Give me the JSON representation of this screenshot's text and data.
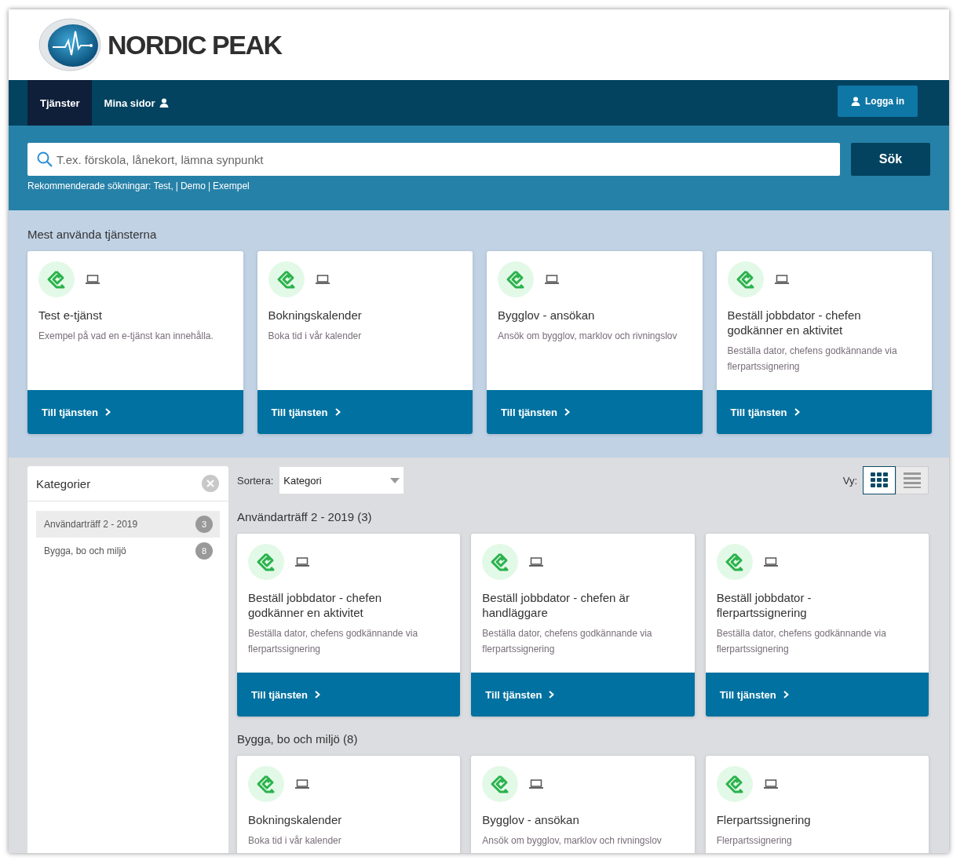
{
  "logo": {
    "text": "NORDIC PEAK"
  },
  "nav": {
    "tabs": [
      {
        "label": "Tjänster",
        "selected": true,
        "kind": "plain"
      },
      {
        "label": "Mina sidor",
        "selected": false,
        "kind": "user"
      }
    ],
    "login_button": "Logga in"
  },
  "search": {
    "placeholder": "T.ex. förskola, lånekort, lämna synpunkt",
    "button": "Sök",
    "recommended_label": "Rekommenderade sökningar:",
    "recommended": [
      "Test,",
      "Demo",
      "Exempel"
    ],
    "separators": [
      "|",
      "|"
    ]
  },
  "most_used": {
    "title": "Mest använda tjänsterna",
    "cards": [
      {
        "title": "Test e-tjänst",
        "description": "Exempel på vad en e-tjänst kan innehålla.",
        "button": "Till tjänsten"
      },
      {
        "title": "Bokningskalender",
        "description": "Boka tid i vår kalender",
        "button": "Till tjänsten"
      },
      {
        "title": "Bygglov - ansökan",
        "description": "Ansök om bygglov, marklov och rivningslov",
        "button": "Till tjänsten"
      },
      {
        "title": "Beställ jobbdator - chefen godkänner en aktivitet",
        "description": "Beställa dator, chefens godkännande via flerpartssignering",
        "button": "Till tjänsten"
      }
    ]
  },
  "categories": {
    "title": "Kategorier",
    "items": [
      {
        "label": "Användarträff 2 - 2019",
        "count": "3",
        "selected": true
      },
      {
        "label": "Bygga, bo och miljö",
        "count": "8",
        "selected": false
      }
    ]
  },
  "toolbar": {
    "sort_label": "Sortera:",
    "sort_value": "Kategori",
    "view_label": "Vy:",
    "views": [
      {
        "kind": "grid",
        "selected": true
      },
      {
        "kind": "list",
        "selected": false
      }
    ]
  },
  "groups": [
    {
      "title": "Användarträff 2 - 2019 (3)",
      "cards": [
        {
          "title": "Beställ jobbdator - chefen godkänner en aktivitet",
          "description": "Beställa dator, chefens godkännande via flerpartssignering",
          "button": "Till tjänsten"
        },
        {
          "title": "Beställ jobbdator - chefen är handläggare",
          "description": "Beställa dator, chefens godkännande via flerpartssignering",
          "button": "Till tjänsten"
        },
        {
          "title": "Beställ jobbdator - flerpartssignering",
          "description": "Beställa dator, chefens godkännande via flerpartssignering",
          "button": "Till tjänsten"
        }
      ]
    },
    {
      "title": "Bygga, bo och miljö (8)",
      "cards": [
        {
          "title": "Bokningskalender",
          "description": "Boka tid i vår kalender"
        },
        {
          "title": "Bygglov - ansökan",
          "description": "Ansök om bygglov, marklov och rivningslov"
        },
        {
          "title": "Flerpartssignering",
          "description": "Flerpartssignering"
        }
      ]
    }
  ]
}
